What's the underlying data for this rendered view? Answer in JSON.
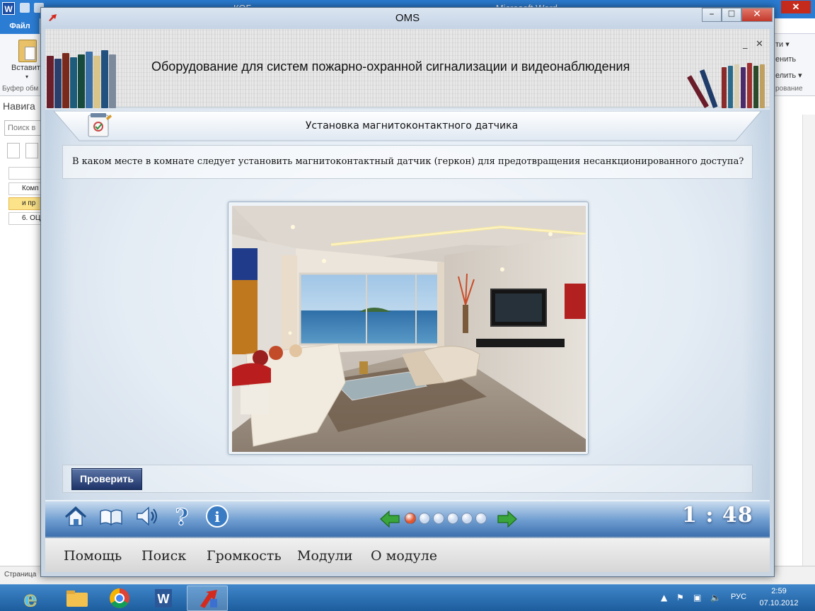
{
  "word": {
    "title_fragment": "КОБ",
    "title_tail": "– Microsoft Word",
    "file_tab": "Файл",
    "paste_label": "Вставит",
    "clipboard_group": "Буфер обм",
    "right_items": [
      "ти ▾",
      "енить",
      "елить ▾"
    ],
    "right_group": "рование",
    "nav": {
      "title": "Навига",
      "search_placeholder": "Поиск в",
      "rows": [
        "Комп",
        "и пр",
        "6. ОЦ"
      ]
    },
    "status_page": "Страница"
  },
  "oms": {
    "window_title": "OMS",
    "banner_title": "Оборудование для систем пожарно-охранной сигнализации и видеонаблюдения",
    "topic_title": "Установка магнитоконтактного датчика",
    "question": "В каком месте в комнате следует установить магнитоконтактный датчик (геркон) для предотвращения несанкционированного доступа?",
    "check_button": "Проверить",
    "timer": "1 : 48",
    "progress": {
      "total": 6,
      "current": 1,
      "active_color": "#e4572e",
      "inactive_color": "#c9d9ef"
    },
    "bottom_menu": [
      "Помощь",
      "Поиск",
      "Громкость",
      "Модули",
      "О модуле"
    ],
    "control_icons": [
      "home-icon",
      "book-icon",
      "speaker-icon",
      "help-icon",
      "info-icon"
    ],
    "colors": {
      "check_button": "#1e3468",
      "control_bar": "#3c70ad"
    }
  },
  "taskbar": {
    "apps": [
      "internet-explorer-icon",
      "file-explorer-icon",
      "chrome-icon",
      "word-icon",
      "oms-icon"
    ],
    "lang": "РУС",
    "time": "2:59",
    "date": "07.10.2012"
  }
}
